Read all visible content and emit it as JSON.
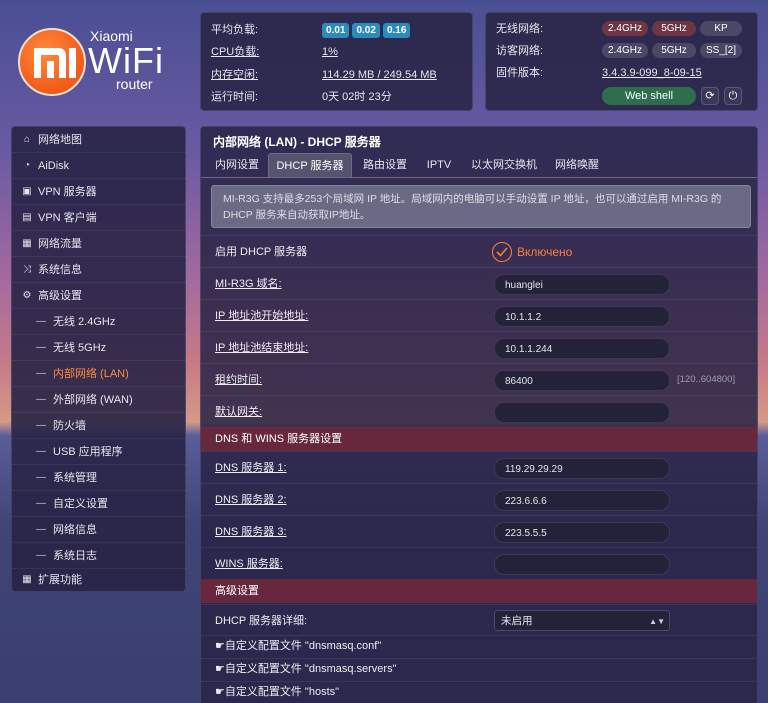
{
  "logo": {
    "brand": "Xiaomi",
    "product": "WiFi",
    "sub": "router"
  },
  "status_left": {
    "load_label": "平均负载:",
    "load_values": [
      "0.01",
      "0.02",
      "0.16"
    ],
    "cpu_label": "CPU负载:",
    "cpu_value": "1%",
    "mem_label": "内存空闲:",
    "mem_value": "114.29 MB / 249.54 MB",
    "uptime_label": "运行时间:",
    "uptime_value": "0天 02时 23分"
  },
  "status_right": {
    "wireless_label": "无线网络:",
    "wireless_pills": [
      "2.4GHz",
      "5GHz",
      "KP"
    ],
    "guest_label": "访客网络:",
    "guest_pills": [
      "2.4GHz",
      "5GHz",
      "SS_[2]"
    ],
    "firmware_label": "固件版本:",
    "firmware_value": "3.4.3.9-099_8-09-15",
    "webshell_label": "Web shell"
  },
  "sidebar": {
    "items": [
      {
        "label": "网络地图",
        "icon": "home-icon"
      },
      {
        "label": "AiDisk",
        "icon": "disk-icon"
      },
      {
        "label": "VPN 服务器",
        "icon": "vpn-server-icon"
      },
      {
        "label": "VPN 客户端",
        "icon": "vpn-client-icon"
      },
      {
        "label": "网络流量",
        "icon": "traffic-icon"
      },
      {
        "label": "系统信息",
        "icon": "system-info-icon"
      },
      {
        "label": "高级设置",
        "icon": "settings-gear-icon"
      }
    ],
    "sub_items": [
      "无线 2.4GHz",
      "无线 5GHz",
      "内部网络 (LAN)",
      "外部网络 (WAN)",
      "防火墙",
      "USB 应用程序",
      "系统管理",
      "自定义设置",
      "网络信息",
      "系统日志"
    ],
    "extra": {
      "label": "扩展功能",
      "icon": "grid-icon"
    }
  },
  "main": {
    "title": "内部网络 (LAN) - DHCP 服务器",
    "tabs": [
      "内网设置",
      "DHCP 服务器",
      "路由设置",
      "IPTV",
      "以太网交换机",
      "网络唤醒"
    ],
    "info": "MI-R3G 支持最多253个局域网 IP 地址。局域网内的电脑可以手动设置 IP 地址，也可以通过启用 MI-R3G 的 DHCP 服务来自动获取IP地址。",
    "enable_label": "启用 DHCP 服务器",
    "enable_state": "Включено",
    "fields": [
      {
        "label": "MI-R3G 域名:",
        "value": ""
      },
      {
        "label": "IP 地址池开始地址:",
        "value": "10.1.1.2"
      },
      {
        "label": "IP 地址池结束地址:",
        "value": "10.1.1.244"
      },
      {
        "label": "租约时间:",
        "value": "86400",
        "hint": "[120..604800]"
      },
      {
        "label": "默认网关:",
        "value": ""
      }
    ],
    "domain_value": "huanglei",
    "dns_section": "DNS 和 WINS 服务器设置",
    "dns_fields": [
      {
        "label": "DNS 服务器 1:",
        "value": "119.29.29.29"
      },
      {
        "label": "DNS 服务器 2:",
        "value": "223.6.6.6"
      },
      {
        "label": "DNS 服务器 3:",
        "value": "223.5.5.5"
      },
      {
        "label": "WINS 服务器:",
        "value": ""
      }
    ],
    "adv_section": "高级设置",
    "dhcp_detail_label": "DHCP 服务器详细:",
    "dhcp_detail_value": "未启用",
    "custom_files": [
      "自定义配置文件 \"dnsmasq.conf\"",
      "自定义配置文件 \"dnsmasq.servers\"",
      "自定义配置文件 \"hosts\""
    ]
  },
  "colors": {
    "accent": "#ff7f3d",
    "section_bg": "#6e283c",
    "load_pill": "#2b8bbd",
    "webshell": "#2d6e4d"
  }
}
